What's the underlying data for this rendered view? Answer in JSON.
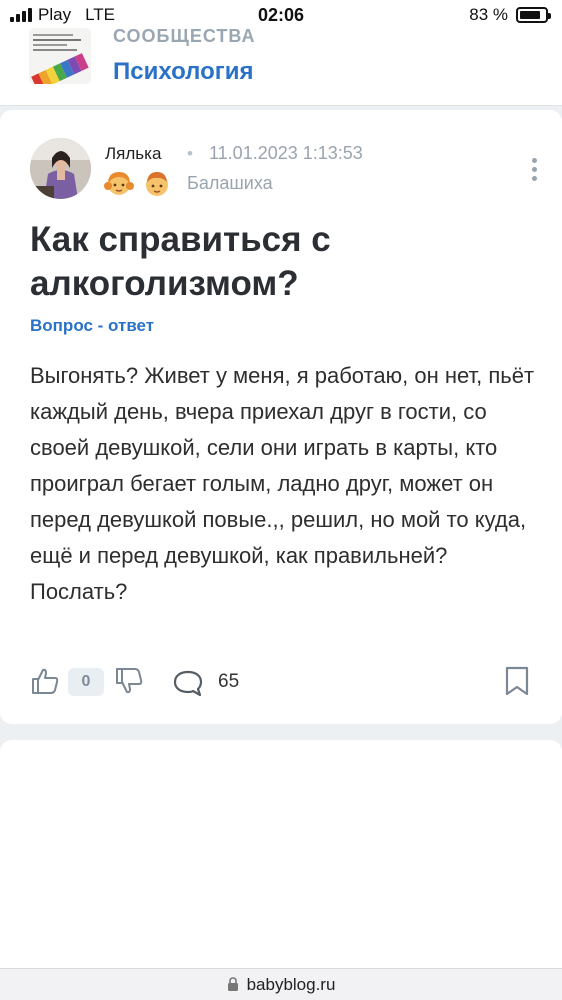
{
  "status_bar": {
    "carrier": "Play",
    "network": "LTE",
    "time": "02:06",
    "battery_text": "83 %",
    "battery_level": 0.83
  },
  "community": {
    "kicker": "СООБЩЕСТВА",
    "name": "Психология",
    "thumb_icon": "psychology-dictionary-thumbnail"
  },
  "post": {
    "author": "Лялька",
    "separator": "•",
    "date": "11.01.2023 1:13:53",
    "location": "Балашиха",
    "badges": [
      "girl-emoji-icon",
      "boy-emoji-icon"
    ],
    "title": "Как справиться с алкоголизмом?",
    "tag": "Вопрос - ответ",
    "body": "Выгонять? Живет у меня, я работаю, он нет, пьёт каждый день, вчера приехал друг в гости, со своей девушкой, сели они играть в карты, кто проиграл бегает голым, ладно друг, может он перед девушкой повые.,, решил, но мой то куда, ещё и перед девушкой, как правильней? Послать?",
    "likes": "0",
    "comments": "65"
  },
  "url_bar": {
    "domain": "babyblog.ru"
  },
  "colors": {
    "accent": "#2a72c7",
    "muted": "#9aa4ae",
    "page_bg": "#edf0f3"
  }
}
